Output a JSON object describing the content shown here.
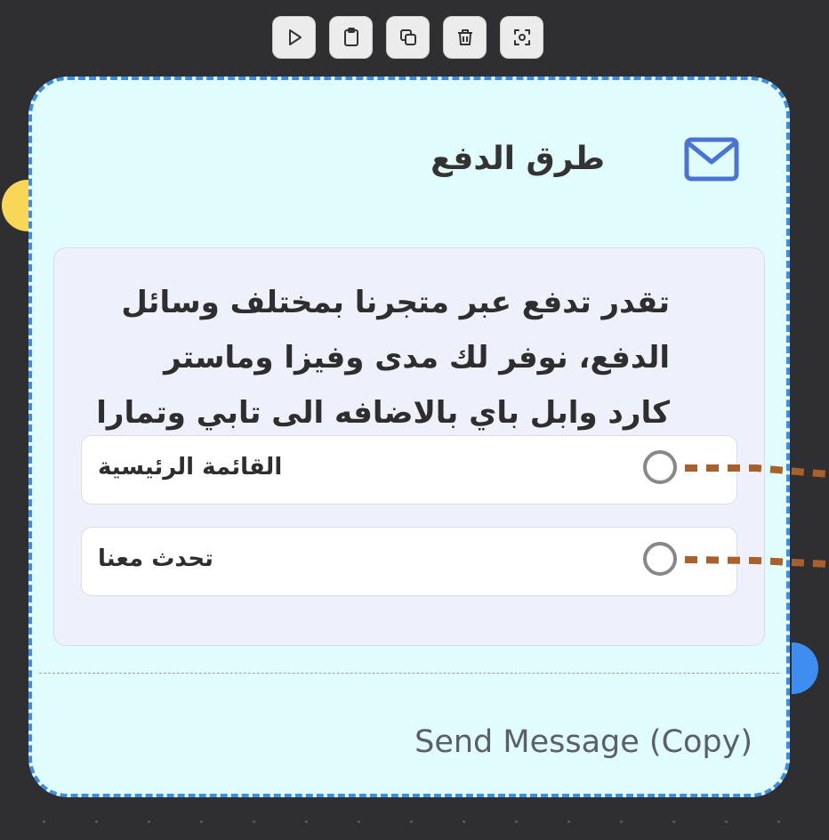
{
  "toolbar": {
    "buttons": [
      {
        "name": "run-button",
        "icon": "play-icon"
      },
      {
        "name": "paste-button",
        "icon": "clipboard-icon"
      },
      {
        "name": "duplicate-button",
        "icon": "copy-icon"
      },
      {
        "name": "delete-button",
        "icon": "trash-icon"
      },
      {
        "name": "focus-button",
        "icon": "focus-frame-icon"
      }
    ]
  },
  "node": {
    "title": "طرق الدفع",
    "icon": "mail-icon",
    "message": "تقدر تدفع عبر متجرنا بمختلف وسائل الدفع، نوفر لك مدى وفيزا وماستر كارد وابل باي بالاضافه الى تابي وتمارا",
    "options": [
      {
        "label": "القائمة الرئيسية"
      },
      {
        "label": "تحدث معنا"
      }
    ],
    "footer": "Send Message (Copy)"
  },
  "colors": {
    "canvas": "#2f2f31",
    "card_bg": "#e1fcfd",
    "card_border": "#3f8de0",
    "input_handle": "#f8d657",
    "output_handle": "#3e8ef2",
    "connector": "#a8612c",
    "mail_icon": "#4a74d4"
  }
}
